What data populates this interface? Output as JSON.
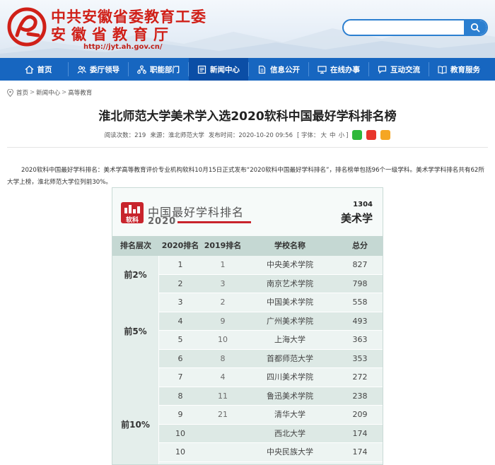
{
  "header": {
    "org_line1": "中共安徽省委教育工委",
    "org_line2": "安徽省教育厅",
    "url": "http://jyt.ah.gov.cn/",
    "search_placeholder": ""
  },
  "nav": {
    "items": [
      {
        "label": "首页",
        "icon": "home-icon"
      },
      {
        "label": "委厅领导",
        "icon": "people-icon"
      },
      {
        "label": "职能部门",
        "icon": "org-icon"
      },
      {
        "label": "新闻中心",
        "icon": "news-icon"
      },
      {
        "label": "信息公开",
        "icon": "doc-icon"
      },
      {
        "label": "在线办事",
        "icon": "monitor-icon"
      },
      {
        "label": "互动交流",
        "icon": "chat-icon"
      },
      {
        "label": "教育服务",
        "icon": "book-icon"
      }
    ],
    "active_index": 3
  },
  "breadcrumb": {
    "items": [
      "首页",
      "新闻中心",
      "高等教育"
    ],
    "separator": ">"
  },
  "article": {
    "title": "淮北师范大学美术学入选2020软科中国最好学科排名榜",
    "views_label": "阅读次数：",
    "views": "219",
    "source_label": "来源：",
    "source": "淮北师范大学",
    "time_label": "发布时间：",
    "time": "2020-10-20 09:56",
    "font_label": "[ 字体：",
    "font_large": "大",
    "font_medium": "中",
    "font_small": "小",
    "font_close": "]",
    "paragraph": "2020软科中国最好学科排名：美术学高等教育评价专业机构软科10月15日正式发布“2020软科中国最好学科排名”，排名榜单包括96个一级学科。美术学学科排名共有62所大学上榜，淮北师范大学位列前30%。"
  },
  "ranking": {
    "logo_text": "软科",
    "heading": "中国最好学科排名",
    "year": "2020",
    "code": "1304",
    "subject": "美术学",
    "columns": [
      "排名层次",
      "2020排名",
      "2019排名",
      "学校名称",
      "总分"
    ],
    "tiers": [
      {
        "label": "前2%",
        "rows": 2
      },
      {
        "label": "前5%",
        "rows": 4
      },
      {
        "label": "前10%",
        "rows": 6
      }
    ],
    "rows": [
      {
        "r2020": "1",
        "r2019": "1",
        "school": "中央美术学院",
        "score": "827"
      },
      {
        "r2020": "2",
        "r2019": "3",
        "school": "南京艺术学院",
        "score": "798"
      },
      {
        "r2020": "3",
        "r2019": "2",
        "school": "中国美术学院",
        "score": "558"
      },
      {
        "r2020": "4",
        "r2019": "9",
        "school": "广州美术学院",
        "score": "493"
      },
      {
        "r2020": "5",
        "r2019": "10",
        "school": "上海大学",
        "score": "363"
      },
      {
        "r2020": "6",
        "r2019": "8",
        "school": "首都师范大学",
        "score": "353"
      },
      {
        "r2020": "7",
        "r2019": "4",
        "school": "四川美术学院",
        "score": "272"
      },
      {
        "r2020": "8",
        "r2019": "11",
        "school": "鲁迅美术学院",
        "score": "238"
      },
      {
        "r2020": "9",
        "r2019": "21",
        "school": "清华大学",
        "score": "209"
      },
      {
        "r2020": "10",
        "r2019": "",
        "school": "西北大学",
        "score": "174"
      },
      {
        "r2020": "10",
        "r2019": "",
        "school": "中央民族大学",
        "score": "174"
      }
    ]
  },
  "colors": {
    "brand_red": "#d02018",
    "nav_blue": "#1766c0",
    "nav_active": "#0b4ea6",
    "ranking_red": "#c8242c"
  }
}
